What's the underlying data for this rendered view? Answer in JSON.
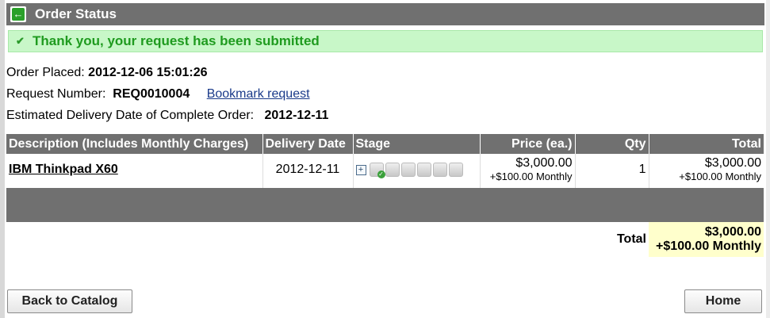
{
  "title_bar": {
    "title": "Order Status",
    "back_icon": "back-arrow-icon"
  },
  "notice": {
    "icon": "check-icon",
    "text": "Thank you, your request has been submitted",
    "color": "#1f9b1f",
    "background": "#c8f7c8"
  },
  "order_info": {
    "placed_label": "Order Placed:",
    "placed_value": "2012-12-06 15:01:26",
    "request_label": "Request Number:",
    "request_value": "REQ0010004",
    "bookmark_link": "Bookmark request",
    "delivery_label": "Estimated Delivery Date of Complete Order:",
    "delivery_value": "2012-12-11"
  },
  "table": {
    "headers": {
      "description": "Description (Includes Monthly Charges)",
      "delivery_date": "Delivery Date",
      "stage": "Stage",
      "price": "Price (ea.)",
      "qty": "Qty",
      "total": "Total"
    },
    "rows": [
      {
        "description": "IBM Thinkpad X60",
        "delivery_date": "2012-12-11",
        "stage_boxes": 6,
        "stage_completed": 1,
        "price": "$3,000.00",
        "price_monthly": "+$100.00 Monthly",
        "qty": "1",
        "total": "$3,000.00",
        "total_monthly": "+$100.00 Monthly"
      }
    ],
    "total_label": "Total",
    "grand_total": "$3,000.00",
    "grand_total_monthly": "+$100.00 Monthly"
  },
  "buttons": {
    "back_to_catalog": "Back to Catalog",
    "home": "Home"
  },
  "colors": {
    "header_bar": "#707070",
    "total_highlight": "#ffffcc",
    "link": "#1a3a8a"
  }
}
